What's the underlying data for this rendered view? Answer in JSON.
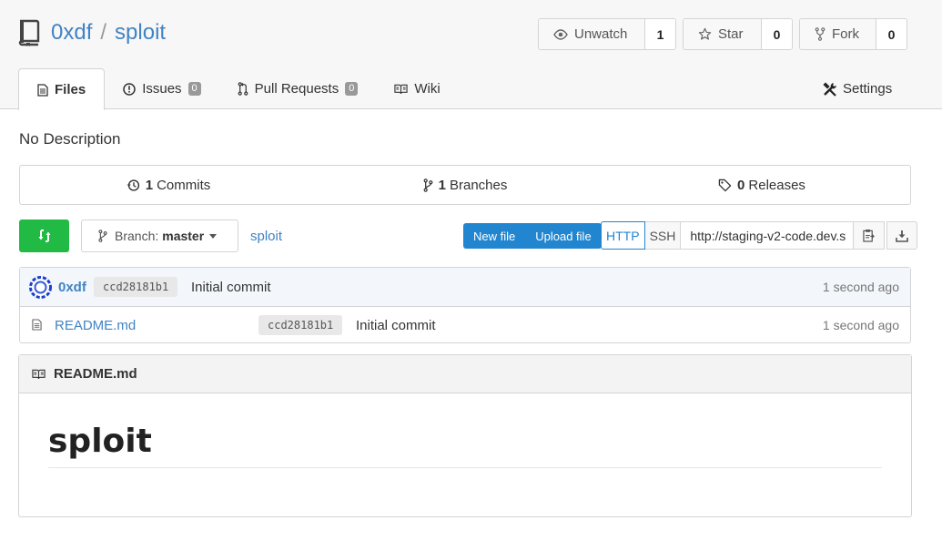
{
  "repo": {
    "owner": "0xdf",
    "separator": "/",
    "name": "sploit",
    "description": "No Description"
  },
  "actions": {
    "watch": {
      "label": "Unwatch",
      "count": "1"
    },
    "star": {
      "label": "Star",
      "count": "0"
    },
    "fork": {
      "label": "Fork",
      "count": "0"
    }
  },
  "tabs": [
    {
      "label": "Files",
      "icon": "file-text-icon",
      "active": true
    },
    {
      "label": "Issues",
      "icon": "issue-opened-icon",
      "badge": "0"
    },
    {
      "label": "Pull Requests",
      "icon": "git-pull-request-icon",
      "badge": "0"
    },
    {
      "label": "Wiki",
      "icon": "book-icon"
    }
  ],
  "settings_tab": {
    "label": "Settings",
    "icon": "tools-icon"
  },
  "stats": {
    "commits": {
      "count": "1",
      "label": "Commits"
    },
    "branches": {
      "count": "1",
      "label": "Branches"
    },
    "releases": {
      "count": "0",
      "label": "Releases"
    }
  },
  "toolbar": {
    "branch_prefix": "Branch:",
    "branch_name": "master",
    "path": "sploit",
    "new_file": "New file",
    "upload_file": "Upload file",
    "http": "HTTP",
    "ssh": "SSH",
    "clone_url": "http://staging-v2-code.dev.s"
  },
  "latest_commit": {
    "user": "0xdf",
    "sha": "ccd28181b1",
    "message": "Initial commit",
    "time": "1 second ago"
  },
  "files": [
    {
      "name": "README.md",
      "sha": "ccd28181b1",
      "message": "Initial commit",
      "time": "1 second ago"
    }
  ],
  "readme": {
    "filename": "README.md",
    "heading": "sploit"
  },
  "colors": {
    "link": "#4183c4",
    "primary": "#2185d0",
    "green": "#21ba45"
  }
}
